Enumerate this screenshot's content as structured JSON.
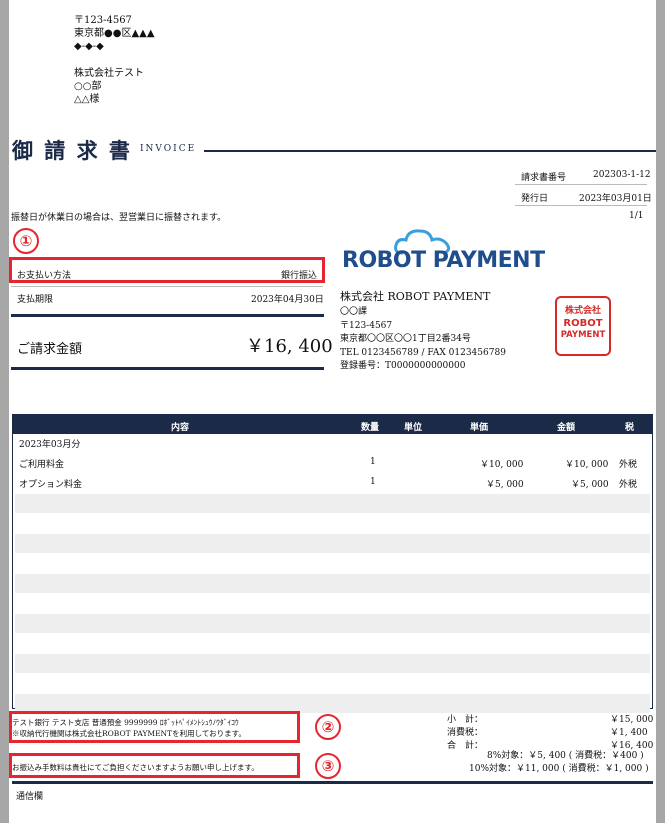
{
  "address": {
    "postal": "〒123-4567",
    "line1": "東京都●●区▲▲▲",
    "line2": "◆-◆-◆",
    "company": "株式会社テスト",
    "dept": "○○部",
    "name": "△△様"
  },
  "title": {
    "jp": "御 請 求 書",
    "en": "INVOICE"
  },
  "meta": {
    "invoice_no_label": "請求書番号",
    "invoice_no": "202303-1-12",
    "issue_label": "発行日",
    "issue_date": "2023年03月01日",
    "page": "1/1"
  },
  "notice": "振替日が休業日の場合は、翌営業日に振替されます。",
  "payment": {
    "method_label": "お支払い方法",
    "method_value": "銀行振込",
    "due_label": "支払期限",
    "due_value": "2023年04月30日",
    "amount_label": "ご請求金額",
    "amount_value": "￥16, 400"
  },
  "issuer": {
    "logo_robot": "ROBOT",
    "logo_payment": "PAYMENT",
    "company": "株式会社 ROBOT PAYMENT",
    "division": "〇〇課",
    "postal": "〒123-4567",
    "address": "東京都〇〇区〇〇1丁目2番34号",
    "tel": "TEL 0123456789 / FAX 0123456789",
    "reg": "登録番号：T0000000000000",
    "stamp_line1": "株式会社",
    "stamp_line2": "ROBOT",
    "stamp_line3": "PAYMENT"
  },
  "table": {
    "headers": [
      "内容",
      "数量",
      "単位",
      "単価",
      "金額",
      "税"
    ],
    "rows": [
      {
        "content": "2023年03月分",
        "qty": "",
        "unit": "",
        "price": "",
        "amount": "",
        "tax": ""
      },
      {
        "content": "ご利用料金",
        "qty": "1",
        "unit": "",
        "price": "￥10, 000",
        "amount": "￥10, 000",
        "tax": "外税"
      },
      {
        "content": "オプション料金",
        "qty": "1",
        "unit": "",
        "price": "￥5, 000",
        "amount": "￥5, 000",
        "tax": "外税"
      }
    ]
  },
  "bank": {
    "line1": "テスト銀行 テスト支店 普通預金 9999999 ﾛﾎﾞｯﾄﾍﾟｲﾒﾝﾄｼｭｳﾉｳﾀﾞｲｺｳ",
    "line2": "※収納代行機関は株式会社ROBOT PAYMENTを利用しております。",
    "fee": "お振込み手数料は貴社にてご負担くださいますようお願い申し上げます。"
  },
  "totals": {
    "subtotal_label": "小　計：",
    "subtotal": "￥15, 000",
    "tax_label": "消費税：",
    "tax": "￥1, 400",
    "total_label": "合　計：",
    "total": "￥16, 400",
    "rate8": "8%対象：￥5, 400 ( 消費税：￥400 )",
    "rate10": "10%対象：￥11, 000 ( 消費税：￥1, 000 )"
  },
  "memo_label": "通信欄",
  "annotations": [
    "①",
    "②",
    "③"
  ],
  "colors": {
    "navy": "#1b2a47",
    "annotation_red": "#e5262f",
    "logo_blue": "#1f4e8c",
    "logo_cloud": "#3aa0dc",
    "stamp_red": "#d62a2a"
  }
}
